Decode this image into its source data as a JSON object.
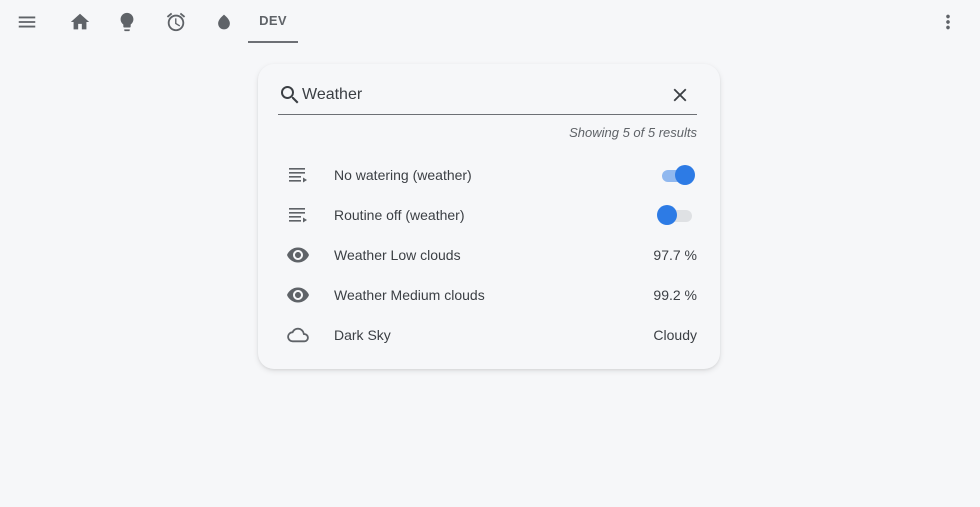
{
  "topbar": {
    "icons": [
      "menu-icon",
      "home-icon",
      "lightbulb-icon",
      "alarm-icon",
      "water-drop-icon",
      "more-vert-icon"
    ],
    "active_tab_label": "DEV"
  },
  "search": {
    "value": "Weather",
    "results_text": "Showing 5 of 5 results"
  },
  "rows": [
    {
      "icon": "script-icon",
      "label": "No watering (weather)",
      "state": "on"
    },
    {
      "icon": "script-icon",
      "label": "Routine off (weather)",
      "state": "off"
    },
    {
      "icon": "eye-icon",
      "label": "Weather Low clouds",
      "value": "97.7 %"
    },
    {
      "icon": "eye-icon",
      "label": "Weather Medium clouds",
      "value": "99.2 %"
    },
    {
      "icon": "cloud-icon",
      "label": "Dark Sky",
      "value": "Cloudy"
    }
  ],
  "colors": {
    "accent": "#2d7be5",
    "background": "#f6f7f9",
    "text": "#3b3f44"
  }
}
